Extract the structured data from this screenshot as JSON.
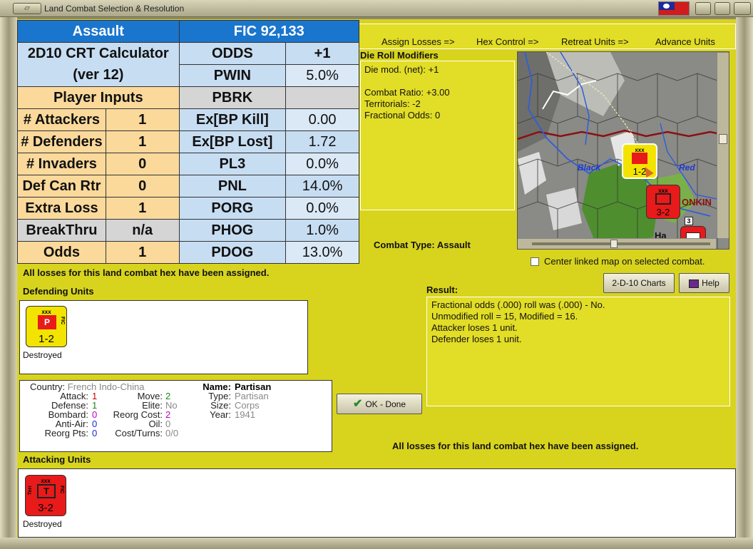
{
  "window": {
    "title": "Land Combat Selection & Resolution"
  },
  "steps": [
    "Assign Losses =>",
    "Hex Control =>",
    "Retreat Units =>",
    "Advance Units"
  ],
  "crt": {
    "header_left": "Assault",
    "header_right": "FIC 92,133",
    "calc_title_1": "2D10 CRT Calculator",
    "calc_title_2": "(ver 12)",
    "player_inputs": "Player Inputs",
    "inputs": [
      {
        "label": "# Attackers",
        "value": "1"
      },
      {
        "label": "# Defenders",
        "value": "1"
      },
      {
        "label": "# Invaders",
        "value": "0"
      },
      {
        "label": "Def Can Rtr",
        "value": "0"
      },
      {
        "label": "Extra Loss",
        "value": "1"
      },
      {
        "label": "BreakThru",
        "value": "n/a"
      },
      {
        "label": "Odds",
        "value": "1"
      }
    ],
    "outputs": [
      {
        "label": "ODDS",
        "value": "+1"
      },
      {
        "label": "PWIN",
        "value": "5.0%"
      },
      {
        "label": "PBRK",
        "value": ""
      },
      {
        "label": "Ex[BP Kill]",
        "value": "0.00"
      },
      {
        "label": "Ex[BP Lost]",
        "value": "1.72"
      },
      {
        "label": "PL3",
        "value": "0.0%"
      },
      {
        "label": "PNL",
        "value": "14.0%"
      },
      {
        "label": "PORG",
        "value": "0.0%"
      },
      {
        "label": "PHOG",
        "value": "1.0%"
      },
      {
        "label": "PDOG",
        "value": "13.0%"
      }
    ]
  },
  "drm": {
    "label": "Die Roll Modifiers",
    "lines": [
      "Die mod. (net): +1",
      "",
      "Combat Ratio: +3.00",
      "Territorials: -2",
      "Fractional Odds: 0"
    ]
  },
  "map": {
    "labels": [
      "Black",
      "Red",
      "ONKIN",
      "Ha"
    ],
    "units": [
      {
        "cls": "xxx",
        "strength": "1-2",
        "color": "#f2e400"
      },
      {
        "cls": "xxx",
        "strength": "3-2",
        "color": "#e81a1a"
      }
    ],
    "badge": "3"
  },
  "combat_type": {
    "label": "Combat Type:",
    "value": "Assault"
  },
  "center_map_label": "Center linked map on selected combat.",
  "buttons": {
    "charts": "2-D-10 Charts",
    "help": "Help",
    "ok": "OK - Done"
  },
  "losses_msg_top": "All losses for this land combat hex have been assigned.",
  "losses_msg_bottom": "All losses for this land combat hex have been assigned.",
  "defending": {
    "label": "Defending Units",
    "unit": {
      "cls": "xxx",
      "type_letter": "P",
      "side": "FIC",
      "strength": "1-2",
      "status": "Destroyed",
      "color": "#f2e400"
    }
  },
  "attacking": {
    "label": "Attacking Units",
    "unit": {
      "cls": "xxx",
      "type_letter": "T",
      "side": "FIC",
      "lside": "Terr",
      "strength": "3-2",
      "status": "Destroyed",
      "color": "#e81a1a"
    }
  },
  "unit_info": {
    "country": {
      "k": "Country:",
      "v": "French Indo-China"
    },
    "attack": {
      "k": "Attack:",
      "v": "1"
    },
    "defense": {
      "k": "Defense:",
      "v": "1"
    },
    "bombard": {
      "k": "Bombard:",
      "v": "0"
    },
    "antiair": {
      "k": "Anti-Air:",
      "v": "0"
    },
    "reorg_pts": {
      "k": "Reorg Pts:",
      "v": "0"
    },
    "move": {
      "k": "Move:",
      "v": "2"
    },
    "elite": {
      "k": "Elite:",
      "v": "No"
    },
    "reorg_cost": {
      "k": "Reorg Cost:",
      "v": "2"
    },
    "oil": {
      "k": "Oil:",
      "v": "0"
    },
    "cost_turns": {
      "k": "Cost/Turns:",
      "v": "0/0"
    },
    "name": {
      "k": "Name:",
      "v": "Partisan"
    },
    "type": {
      "k": "Type:",
      "v": "Partisan"
    },
    "size": {
      "k": "Size:",
      "v": "Corps"
    },
    "year": {
      "k": "Year:",
      "v": "1941"
    }
  },
  "result": {
    "label": "Result:",
    "lines": [
      "Fractional odds (.000) roll was (.000)  - No.",
      "Unmodified roll = 15, Modified = 16.",
      "Attacker loses 1 unit.",
      "Defender loses 1 unit."
    ]
  }
}
